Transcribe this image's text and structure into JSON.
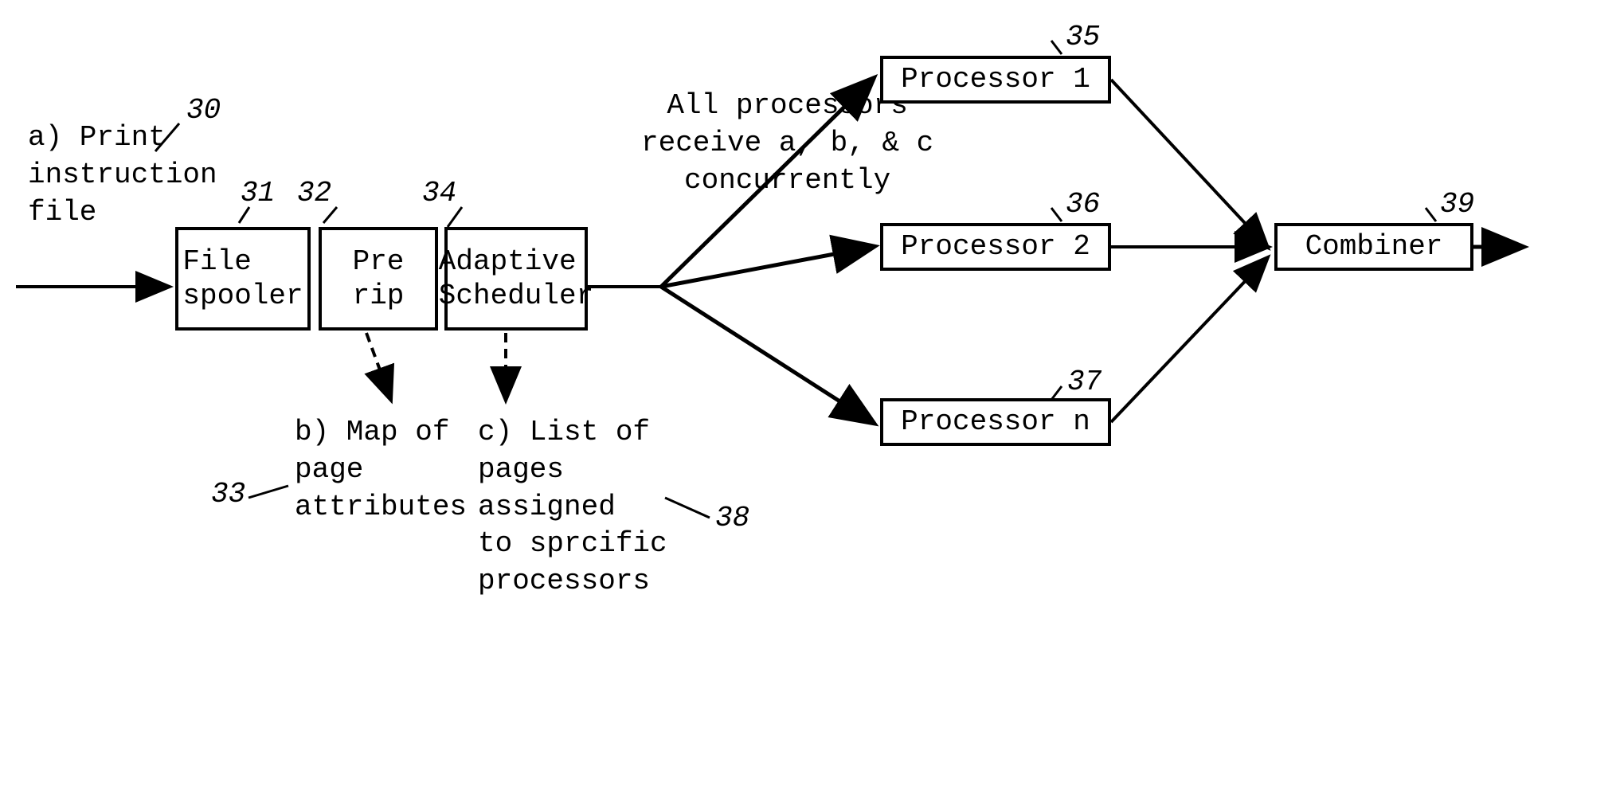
{
  "input": {
    "label": "a) Print\ninstruction\nfile",
    "ref": "30"
  },
  "fileSpooler": {
    "label": "File\nspooler",
    "ref": "31"
  },
  "preRip": {
    "label": "Pre rip",
    "ref": "32",
    "output": "b) Map of\npage\nattributes",
    "outputRef": "33"
  },
  "adaptiveScheduler": {
    "label": "Adaptive\nScheduler",
    "ref": "34",
    "output": "c) List of\npages\nassigned\nto sprcific\nprocessors",
    "outputRef": "38"
  },
  "distribution": {
    "label": "All processors\nreceive a, b, & c\nconcurrently"
  },
  "processor1": {
    "label": "Processor 1",
    "ref": "35"
  },
  "processor2": {
    "label": "Processor 2",
    "ref": "36"
  },
  "processorN": {
    "label": "Processor n",
    "ref": "37"
  },
  "combiner": {
    "label": "Combiner",
    "ref": "39"
  }
}
